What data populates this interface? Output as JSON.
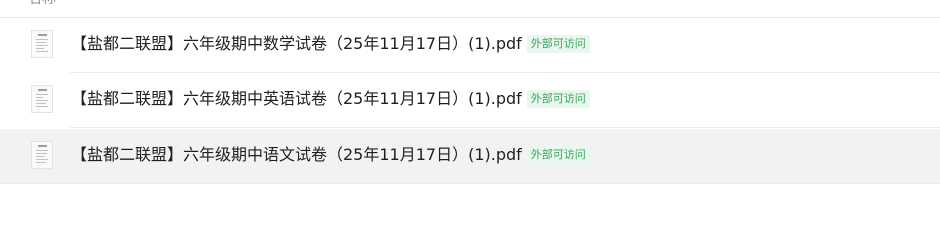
{
  "header": {
    "name_column": "名称"
  },
  "files": [
    {
      "name": "【盐都二联盟】六年级期中数学试卷（25年11月17日）(1).pdf",
      "badge": "外部可访问",
      "icon": "pdf-file-icon",
      "selected": false
    },
    {
      "name": "【盐都二联盟】六年级期中英语试卷（25年11月17日）(1).pdf",
      "badge": "外部可访问",
      "icon": "pdf-file-icon",
      "selected": false
    },
    {
      "name": "【盐都二联盟】六年级期中语文试卷（25年11月17日）(1).pdf",
      "badge": "外部可访问",
      "icon": "pdf-file-icon",
      "selected": true
    }
  ]
}
